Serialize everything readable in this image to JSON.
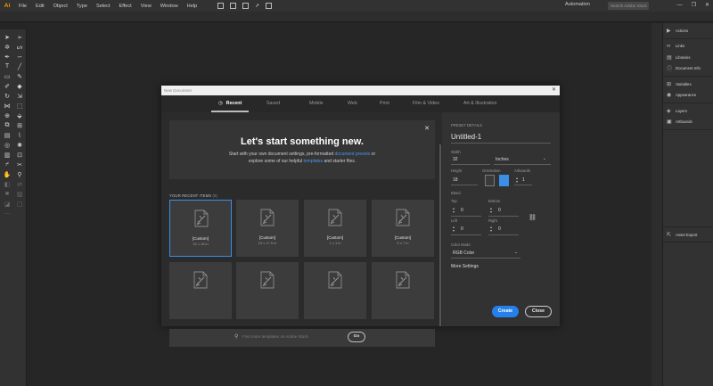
{
  "menubar": {
    "logo": "Ai",
    "items": [
      "File",
      "Edit",
      "Object",
      "Type",
      "Select",
      "Effect",
      "View",
      "Window",
      "Help"
    ],
    "workspace": "Automation",
    "search_placeholder": "Search Adobe Stock",
    "win_minimize": "—",
    "win_maximize": "❐",
    "win_close": "✕"
  },
  "dock": {
    "group1": [
      {
        "icon": "play-icon",
        "glyph": "▶",
        "label": "Actions"
      }
    ],
    "group2": [
      {
        "icon": "link-icon",
        "glyph": "∞",
        "label": "Links"
      },
      {
        "icon": "libraries-icon",
        "glyph": "▤",
        "label": "Libraries"
      },
      {
        "icon": "info-icon",
        "glyph": "ⓘ",
        "label": "Document Info"
      }
    ],
    "group3": [
      {
        "icon": "variables-icon",
        "glyph": "⊞",
        "label": "Variables"
      },
      {
        "icon": "appearance-icon",
        "glyph": "◉",
        "label": "Appearance"
      }
    ],
    "group4": [
      {
        "icon": "layers-icon",
        "glyph": "◈",
        "label": "Layers"
      },
      {
        "icon": "artboards-icon",
        "glyph": "▣",
        "label": "Artboards"
      }
    ],
    "asset_export": {
      "icon": "export-icon",
      "glyph": "⇱",
      "label": "Asset Export"
    }
  },
  "dialog": {
    "title": "New Document",
    "close_glyph": "✕",
    "tabs": [
      "Recent",
      "Saved",
      "Mobile",
      "Web",
      "Print",
      "Film & Video",
      "Art & Illustration"
    ],
    "active_tab": "Recent",
    "hero": {
      "heading": "Let's start something new.",
      "line1_a": "Start with your own document settings, pre-formatted ",
      "line1_link": "document presets",
      "line1_b": " or",
      "line2_a": "explore some of our helpful ",
      "line2_link": "templates",
      "line2_b": " and starter files.",
      "close_glyph": "✕"
    },
    "recent_header": "YOUR RECENT ITEMS",
    "recent_count": "(8)",
    "recent_items": [
      {
        "label": "[Custom]",
        "dims": "32 x 18 in",
        "selected": true
      },
      {
        "label": "[Custom]",
        "dims": "23 x 17.5 in",
        "selected": false
      },
      {
        "label": "[Custom]",
        "dims": "1 x 1 in",
        "selected": false
      },
      {
        "label": "[Custom]",
        "dims": "5 x 7 in",
        "selected": false
      },
      {
        "label": "",
        "dims": "",
        "selected": false
      },
      {
        "label": "",
        "dims": "",
        "selected": false
      },
      {
        "label": "",
        "dims": "",
        "selected": false
      },
      {
        "label": "",
        "dims": "",
        "selected": false
      }
    ],
    "template_search": {
      "placeholder": "Find more templates on Adobe Stock",
      "go_label": "Go"
    },
    "preset": {
      "header": "PRESET DETAILS",
      "name": "Untitled-1",
      "width_label": "Width",
      "width_value": "32",
      "units": "Inches",
      "height_label": "Height",
      "height_value": "18",
      "orientation_label": "Orientation",
      "artboards_label": "Artboards",
      "artboards_value": "1",
      "bleed_label": "Bleed",
      "top_label": "Top",
      "top_value": "0",
      "bottom_label": "Bottom",
      "bottom_value": "0",
      "left_label": "Left",
      "left_value": "0",
      "right_label": "Right",
      "right_value": "0",
      "color_mode_label": "Color Mode",
      "color_mode_value": "RGB Color",
      "more_settings": "More Settings"
    },
    "create_label": "Create",
    "close_label": "Close"
  },
  "colors": {
    "accent": "#2680eb",
    "selection": "#3b8fe6",
    "link": "#4a97f0"
  }
}
